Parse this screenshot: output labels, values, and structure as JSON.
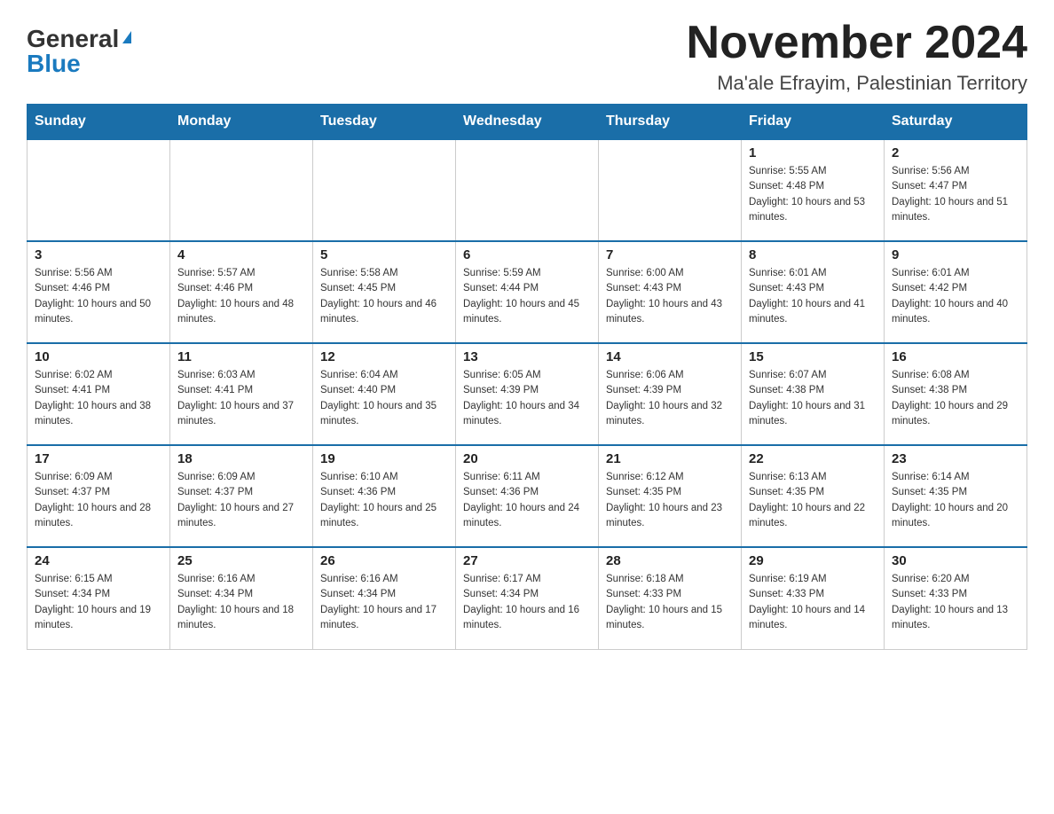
{
  "header": {
    "logo_general": "General",
    "logo_blue": "Blue",
    "month_title": "November 2024",
    "location": "Ma'ale Efrayim, Palestinian Territory"
  },
  "weekdays": [
    "Sunday",
    "Monday",
    "Tuesday",
    "Wednesday",
    "Thursday",
    "Friday",
    "Saturday"
  ],
  "weeks": [
    [
      {
        "day": "",
        "info": ""
      },
      {
        "day": "",
        "info": ""
      },
      {
        "day": "",
        "info": ""
      },
      {
        "day": "",
        "info": ""
      },
      {
        "day": "",
        "info": ""
      },
      {
        "day": "1",
        "info": "Sunrise: 5:55 AM\nSunset: 4:48 PM\nDaylight: 10 hours and 53 minutes."
      },
      {
        "day": "2",
        "info": "Sunrise: 5:56 AM\nSunset: 4:47 PM\nDaylight: 10 hours and 51 minutes."
      }
    ],
    [
      {
        "day": "3",
        "info": "Sunrise: 5:56 AM\nSunset: 4:46 PM\nDaylight: 10 hours and 50 minutes."
      },
      {
        "day": "4",
        "info": "Sunrise: 5:57 AM\nSunset: 4:46 PM\nDaylight: 10 hours and 48 minutes."
      },
      {
        "day": "5",
        "info": "Sunrise: 5:58 AM\nSunset: 4:45 PM\nDaylight: 10 hours and 46 minutes."
      },
      {
        "day": "6",
        "info": "Sunrise: 5:59 AM\nSunset: 4:44 PM\nDaylight: 10 hours and 45 minutes."
      },
      {
        "day": "7",
        "info": "Sunrise: 6:00 AM\nSunset: 4:43 PM\nDaylight: 10 hours and 43 minutes."
      },
      {
        "day": "8",
        "info": "Sunrise: 6:01 AM\nSunset: 4:43 PM\nDaylight: 10 hours and 41 minutes."
      },
      {
        "day": "9",
        "info": "Sunrise: 6:01 AM\nSunset: 4:42 PM\nDaylight: 10 hours and 40 minutes."
      }
    ],
    [
      {
        "day": "10",
        "info": "Sunrise: 6:02 AM\nSunset: 4:41 PM\nDaylight: 10 hours and 38 minutes."
      },
      {
        "day": "11",
        "info": "Sunrise: 6:03 AM\nSunset: 4:41 PM\nDaylight: 10 hours and 37 minutes."
      },
      {
        "day": "12",
        "info": "Sunrise: 6:04 AM\nSunset: 4:40 PM\nDaylight: 10 hours and 35 minutes."
      },
      {
        "day": "13",
        "info": "Sunrise: 6:05 AM\nSunset: 4:39 PM\nDaylight: 10 hours and 34 minutes."
      },
      {
        "day": "14",
        "info": "Sunrise: 6:06 AM\nSunset: 4:39 PM\nDaylight: 10 hours and 32 minutes."
      },
      {
        "day": "15",
        "info": "Sunrise: 6:07 AM\nSunset: 4:38 PM\nDaylight: 10 hours and 31 minutes."
      },
      {
        "day": "16",
        "info": "Sunrise: 6:08 AM\nSunset: 4:38 PM\nDaylight: 10 hours and 29 minutes."
      }
    ],
    [
      {
        "day": "17",
        "info": "Sunrise: 6:09 AM\nSunset: 4:37 PM\nDaylight: 10 hours and 28 minutes."
      },
      {
        "day": "18",
        "info": "Sunrise: 6:09 AM\nSunset: 4:37 PM\nDaylight: 10 hours and 27 minutes."
      },
      {
        "day": "19",
        "info": "Sunrise: 6:10 AM\nSunset: 4:36 PM\nDaylight: 10 hours and 25 minutes."
      },
      {
        "day": "20",
        "info": "Sunrise: 6:11 AM\nSunset: 4:36 PM\nDaylight: 10 hours and 24 minutes."
      },
      {
        "day": "21",
        "info": "Sunrise: 6:12 AM\nSunset: 4:35 PM\nDaylight: 10 hours and 23 minutes."
      },
      {
        "day": "22",
        "info": "Sunrise: 6:13 AM\nSunset: 4:35 PM\nDaylight: 10 hours and 22 minutes."
      },
      {
        "day": "23",
        "info": "Sunrise: 6:14 AM\nSunset: 4:35 PM\nDaylight: 10 hours and 20 minutes."
      }
    ],
    [
      {
        "day": "24",
        "info": "Sunrise: 6:15 AM\nSunset: 4:34 PM\nDaylight: 10 hours and 19 minutes."
      },
      {
        "day": "25",
        "info": "Sunrise: 6:16 AM\nSunset: 4:34 PM\nDaylight: 10 hours and 18 minutes."
      },
      {
        "day": "26",
        "info": "Sunrise: 6:16 AM\nSunset: 4:34 PM\nDaylight: 10 hours and 17 minutes."
      },
      {
        "day": "27",
        "info": "Sunrise: 6:17 AM\nSunset: 4:34 PM\nDaylight: 10 hours and 16 minutes."
      },
      {
        "day": "28",
        "info": "Sunrise: 6:18 AM\nSunset: 4:33 PM\nDaylight: 10 hours and 15 minutes."
      },
      {
        "day": "29",
        "info": "Sunrise: 6:19 AM\nSunset: 4:33 PM\nDaylight: 10 hours and 14 minutes."
      },
      {
        "day": "30",
        "info": "Sunrise: 6:20 AM\nSunset: 4:33 PM\nDaylight: 10 hours and 13 minutes."
      }
    ]
  ]
}
